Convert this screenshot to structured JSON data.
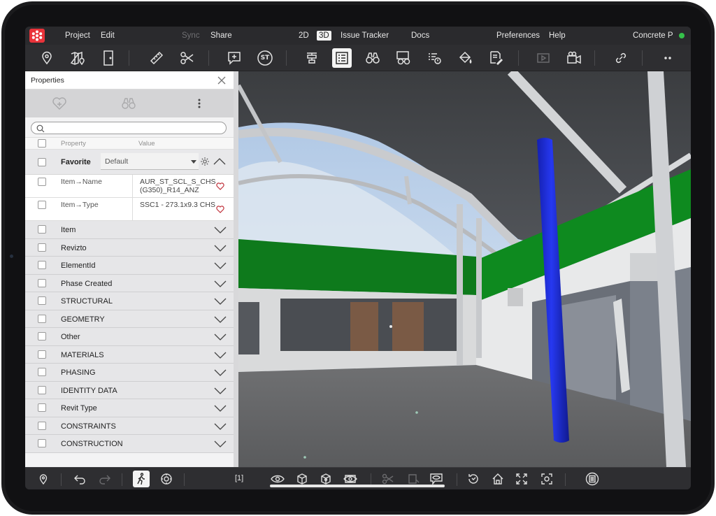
{
  "menubar": {
    "project": "Project",
    "edit": "Edit",
    "sync": "Sync",
    "share": "Share",
    "view_2d": "2D",
    "view_3d": "3D",
    "issue_tracker": "Issue Tracker",
    "docs": "Docs",
    "preferences": "Preferences",
    "help": "Help",
    "project_name": "Concrete P",
    "status_color": "#35c14a"
  },
  "toolbar": {
    "stamp_label": "ST"
  },
  "panel": {
    "title": "Properties",
    "column_property": "Property",
    "column_value": "Value",
    "favorite_label": "Favorite",
    "favorite_value": "Default",
    "properties": [
      {
        "name": "Item→Name",
        "value": "AUR_ST_SCL_S_CHS (G350)_R14_ANZ"
      },
      {
        "name": "Item→Type",
        "value": "SSC1 - 273.1x9.3 CHS"
      }
    ],
    "sections": [
      "Item",
      "Revizto",
      "ElementId",
      "Phase Created",
      "STRUCTURAL",
      "GEOMETRY",
      "Other",
      "MATERIALS",
      "PHASING",
      "IDENTITY DATA",
      "Revit Type",
      "CONSTRAINTS",
      "CONSTRUCTION"
    ]
  },
  "bottombar": {
    "page_indicator": "[1]"
  },
  "colors": {
    "accent_red": "#e9333a",
    "selected_element": "#1d2be0",
    "facade_green": "#0e7a1c"
  }
}
